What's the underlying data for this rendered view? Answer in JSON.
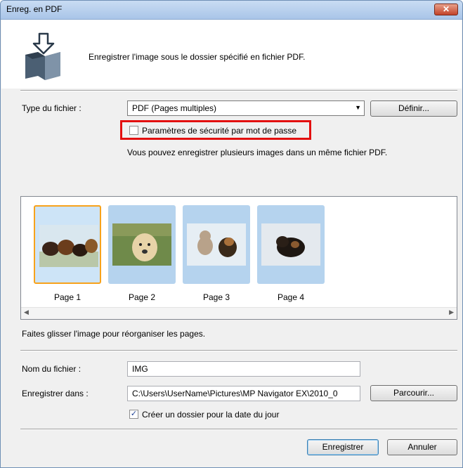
{
  "window": {
    "title": "Enreg. en PDF",
    "close_label": "✕"
  },
  "header": {
    "description": "Enregistrer l'image sous le dossier spécifié en fichier PDF.",
    "icon": "save-pdf-folder-icon"
  },
  "file_type": {
    "label": "Type du fichier :",
    "selected": "PDF (Pages multiples)",
    "define_button": "Définir...",
    "security_checkbox_label": "Paramètres de sécurité par mot de passe",
    "security_checked": false,
    "hint": "Vous pouvez enregistrer plusieurs images dans un même fichier PDF."
  },
  "pages": [
    {
      "label": "Page 1",
      "selected": true
    },
    {
      "label": "Page 2",
      "selected": false
    },
    {
      "label": "Page 3",
      "selected": false
    },
    {
      "label": "Page 4",
      "selected": false
    }
  ],
  "reorder_hint": "Faites glisser l'image pour réorganiser les pages.",
  "filename": {
    "label": "Nom du fichier :",
    "value": "IMG"
  },
  "save_in": {
    "label": "Enregistrer dans :",
    "value": "C:\\Users\\UserName\\Pictures\\MP Navigator EX\\2010_0",
    "browse_button": "Parcourir...",
    "date_folder_label": "Créer un dossier pour la date du jour",
    "date_folder_checked": true
  },
  "footer": {
    "save_button": "Enregistrer",
    "cancel_button": "Annuler"
  },
  "colors": {
    "selection": "#f7a21b",
    "highlight_box": "#e31010",
    "thumb_frame": "#b5d3ee"
  }
}
